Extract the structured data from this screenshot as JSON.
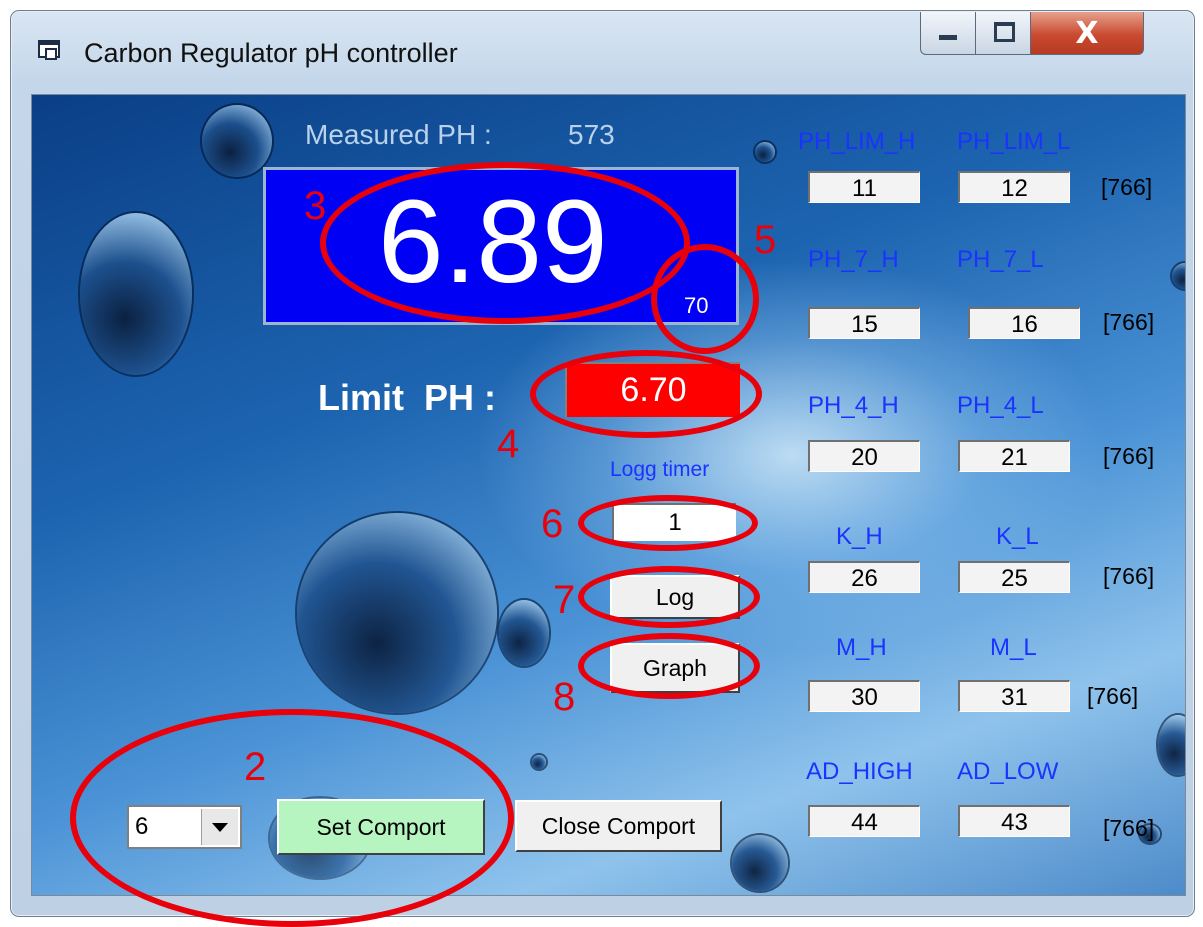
{
  "window": {
    "title": "Carbon Regulator pH controller",
    "close_glyph": "X"
  },
  "display": {
    "measured_label": "Measured PH :",
    "measured_raw": "573",
    "ph_value": "6.89",
    "ph_sub": "70",
    "limit_label": "Limit  PH :",
    "limit_value": "6.70",
    "logg_timer_label": "Logg timer",
    "logg_timer_value": "1"
  },
  "buttons": {
    "log": "Log",
    "graph": "Graph",
    "set_comport": "Set Comport",
    "close_comport": "Close Comport"
  },
  "comport": {
    "selected": "6"
  },
  "params": [
    {
      "label_h": "PH_LIM_H",
      "label_l": "PH_LIM_L",
      "h": "11",
      "l": "12",
      "tag": "[766]"
    },
    {
      "label_h": "PH_7_H",
      "label_l": "PH_7_L",
      "h": "15",
      "l": "16",
      "tag": "[766]"
    },
    {
      "label_h": "PH_4_H",
      "label_l": "PH_4_L",
      "h": "20",
      "l": "21",
      "tag": "[766]"
    },
    {
      "label_h": "K_H",
      "label_l": "K_L",
      "h": "26",
      "l": "25",
      "tag": "[766]"
    },
    {
      "label_h": "M_H",
      "label_l": "M_L",
      "h": "30",
      "l": "31",
      "tag": "[766]"
    },
    {
      "label_h": "AD_HIGH",
      "label_l": "AD_LOW",
      "h": "44",
      "l": "43",
      "tag": "[766]"
    }
  ],
  "annotations": [
    "2",
    "3",
    "4",
    "5",
    "6",
    "7",
    "8"
  ],
  "colors": {
    "ph_display_bg": "#0000f5",
    "limit_bg": "#ff0000",
    "label_blue": "#1a33ff",
    "annotation_red": "#e8000b",
    "set_comport_bg": "#b6f5bf"
  }
}
